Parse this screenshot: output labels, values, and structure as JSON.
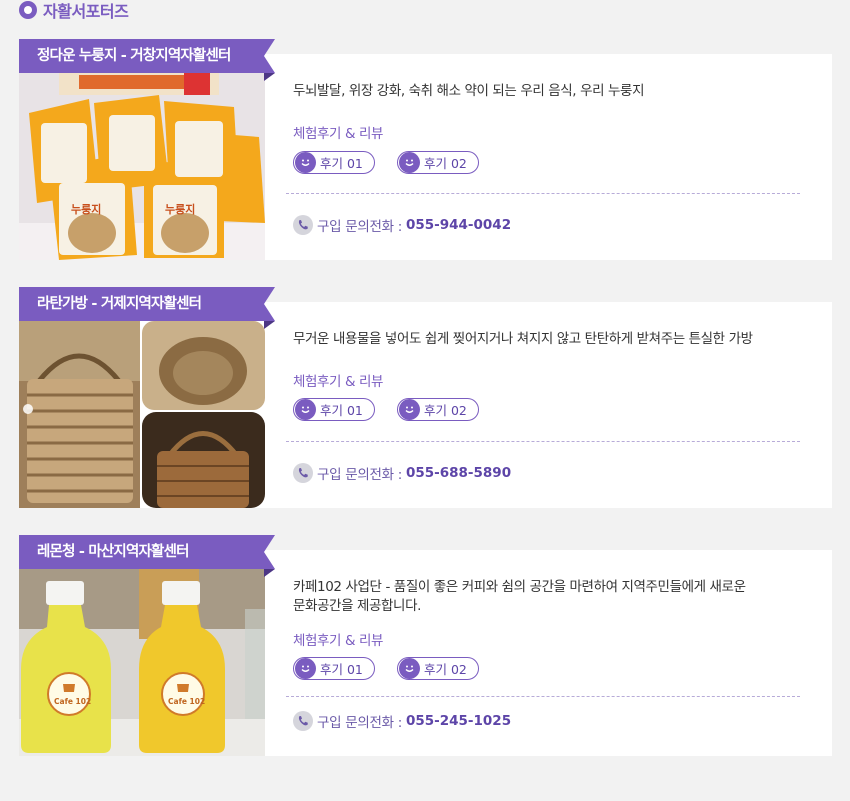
{
  "section": {
    "title": "자활서포터즈",
    "icon": "ring-bullet-icon"
  },
  "accent_color": "#7a5cc0",
  "review_buttons": [
    "후기 01",
    "후기 02"
  ],
  "review_label": "체험후기 & 리뷰",
  "phone_label": "구입 문의전화 :",
  "items": [
    {
      "title": "정다운 누룽지 - 거창지역자활센터",
      "description": "두뇌발달, 위장 강화, 숙취 해소 약이 되는 우리 음식, 우리 누룽지",
      "phone": "055-944-0042",
      "photo_text": "누룽지"
    },
    {
      "title": "라탄가방 - 거제지역자활센터",
      "description": "무거운 내용물을 넣어도 쉽게 찢어지거나 쳐지지 않고 탄탄하게 받쳐주는 튼실한 가방",
      "phone": "055-688-5890"
    },
    {
      "title": "레몬청 - 마산지역자활센터",
      "description_line1": "카페102 사업단 - 품질이 좋은 커피와 쉼의 공간을 마련하여 지역주민들에게 새로운",
      "description_line2": "문화공간을 제공합니다.",
      "phone": "055-245-1025",
      "photo_text": "Cafe 102"
    }
  ]
}
